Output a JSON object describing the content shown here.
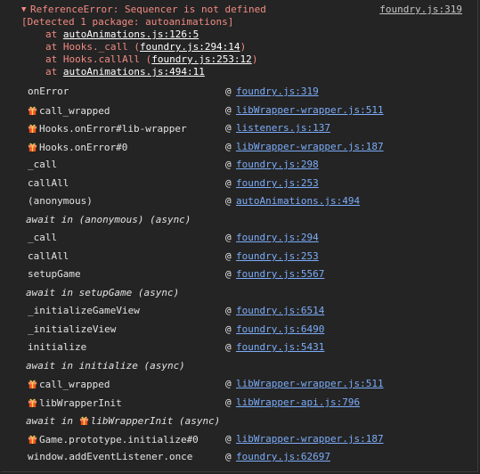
{
  "error": {
    "message": "ReferenceError: Sequencer is not defined",
    "source": "foundry.js:319",
    "detected": "[Detected 1 package: autoanimations]",
    "stack": [
      {
        "prefix": "at ",
        "link": "autoAnimations.js:126:5",
        "suffix": ""
      },
      {
        "prefix": "at Hooks._call (",
        "link": "foundry.js:294:14",
        "suffix": ")"
      },
      {
        "prefix": "at Hooks.callAll (",
        "link": "foundry.js:253:12",
        "suffix": ")"
      },
      {
        "prefix": "at ",
        "link": "autoAnimations.js:494:11",
        "suffix": ""
      }
    ]
  },
  "frames": [
    {
      "fn": "onError",
      "gift": false,
      "loc": "foundry.js:319"
    },
    {
      "fn": "call_wrapped",
      "gift": true,
      "loc": "libWrapper-wrapper.js:511"
    },
    {
      "fn": "Hooks.onError#lib-wrapper",
      "gift": true,
      "loc": "listeners.js:137"
    },
    {
      "fn": "Hooks.onError#0",
      "gift": true,
      "loc": "libWrapper-wrapper.js:187"
    },
    {
      "fn": "_call",
      "gift": false,
      "loc": "foundry.js:298"
    },
    {
      "fn": "callAll",
      "gift": false,
      "loc": "foundry.js:253"
    },
    {
      "fn": "(anonymous)",
      "gift": false,
      "loc": "autoAnimations.js:494"
    },
    {
      "async": "await in (anonymous) (async)"
    },
    {
      "fn": "_call",
      "gift": false,
      "loc": "foundry.js:294"
    },
    {
      "fn": "callAll",
      "gift": false,
      "loc": "foundry.js:253"
    },
    {
      "fn": "setupGame",
      "gift": false,
      "loc": "foundry.js:5567"
    },
    {
      "async": "await in setupGame (async)"
    },
    {
      "fn": "_initializeGameView",
      "gift": false,
      "loc": "foundry.js:6514"
    },
    {
      "fn": "_initializeView",
      "gift": false,
      "loc": "foundry.js:6490"
    },
    {
      "fn": "initialize",
      "gift": false,
      "loc": "foundry.js:5431"
    },
    {
      "async": "await in initialize (async)"
    },
    {
      "fn": "call_wrapped",
      "gift": true,
      "loc": "libWrapper-wrapper.js:511"
    },
    {
      "fn": "libWrapperInit",
      "gift": true,
      "loc": "libWrapper-api.js:796"
    },
    {
      "async_pre": "await in ",
      "async_fn": "libWrapperInit",
      "async_post": " (async)",
      "async_gift": true
    },
    {
      "fn": "Game.prototype.initialize#0",
      "gift": true,
      "loc": "libWrapper-wrapper.js:187"
    },
    {
      "fn": "window.addEventListener.once",
      "gift": false,
      "loc": "foundry.js:62697"
    }
  ],
  "at_symbol": "@",
  "colors": {
    "background": "#242424",
    "error_text": "#f28b82",
    "link": "#7cacf8",
    "gift_icon": "#ff8a65"
  }
}
